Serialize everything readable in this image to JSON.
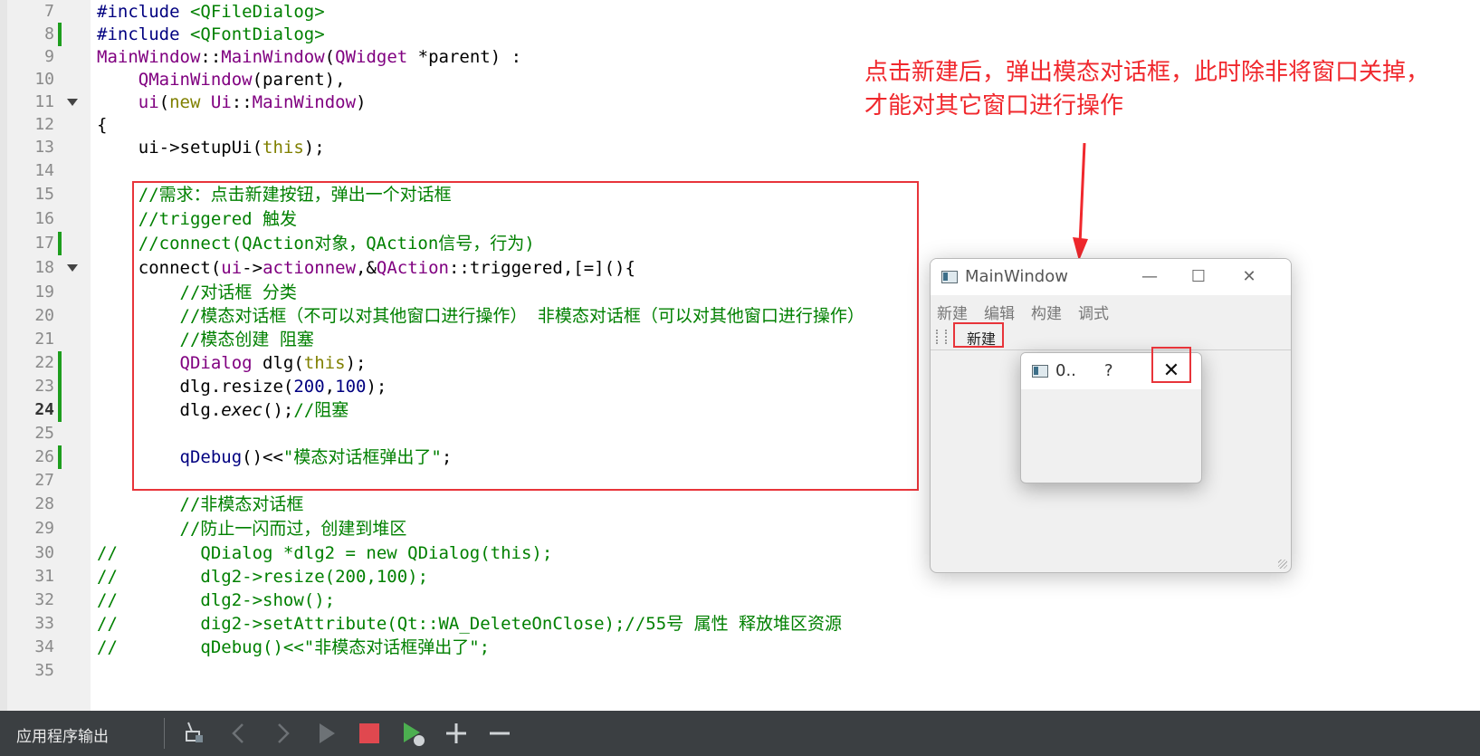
{
  "editor": {
    "lines": [
      {
        "n": "7",
        "segs": [
          {
            "c": "pp",
            "t": "#include "
          },
          {
            "c": "inc",
            "t": "<QFileDialog>"
          }
        ]
      },
      {
        "n": "8",
        "chg": true,
        "segs": [
          {
            "c": "pp",
            "t": "#include "
          },
          {
            "c": "inc",
            "t": "<QFontDialog>"
          }
        ]
      },
      {
        "n": "9",
        "segs": [
          {
            "c": "cls",
            "t": "MainWindow"
          },
          {
            "c": "",
            "t": "::"
          },
          {
            "c": "cls",
            "t": "MainWindow"
          },
          {
            "c": "",
            "t": "("
          },
          {
            "c": "cls",
            "t": "QWidget"
          },
          {
            "c": "",
            "t": " *parent) :"
          }
        ]
      },
      {
        "n": "10",
        "segs": [
          {
            "c": "",
            "t": "    "
          },
          {
            "c": "cls",
            "t": "QMainWindow"
          },
          {
            "c": "",
            "t": "(parent),"
          }
        ]
      },
      {
        "n": "11",
        "fold": true,
        "segs": [
          {
            "c": "",
            "t": "    "
          },
          {
            "c": "cls",
            "t": "ui"
          },
          {
            "c": "",
            "t": "("
          },
          {
            "c": "kw",
            "t": "new"
          },
          {
            "c": "",
            "t": " "
          },
          {
            "c": "cls",
            "t": "Ui"
          },
          {
            "c": "",
            "t": "::"
          },
          {
            "c": "cls",
            "t": "MainWindow"
          },
          {
            "c": "",
            "t": ")"
          }
        ]
      },
      {
        "n": "12",
        "segs": [
          {
            "c": "",
            "t": "{"
          }
        ]
      },
      {
        "n": "13",
        "segs": [
          {
            "c": "",
            "t": "    ui->setupUi("
          },
          {
            "c": "kw",
            "t": "this"
          },
          {
            "c": "",
            "t": ");"
          }
        ]
      },
      {
        "n": "14",
        "segs": []
      },
      {
        "n": "15",
        "segs": [
          {
            "c": "",
            "t": "    "
          },
          {
            "c": "cm",
            "t": "//需求：点击新建按钮，弹出一个对话框"
          }
        ]
      },
      {
        "n": "16",
        "segs": [
          {
            "c": "",
            "t": "    "
          },
          {
            "c": "cm",
            "t": "//triggered 触发"
          }
        ]
      },
      {
        "n": "17",
        "chg": true,
        "segs": [
          {
            "c": "",
            "t": "    "
          },
          {
            "c": "cm",
            "t": "//connect(QAction对象，QAction信号，行为)"
          }
        ]
      },
      {
        "n": "18",
        "fold": true,
        "segs": [
          {
            "c": "",
            "t": "    connect("
          },
          {
            "c": "cls",
            "t": "ui"
          },
          {
            "c": "",
            "t": "->"
          },
          {
            "c": "cls",
            "t": "actionnew"
          },
          {
            "c": "",
            "t": ",&"
          },
          {
            "c": "cls",
            "t": "QAction"
          },
          {
            "c": "",
            "t": "::triggered,[=](){"
          }
        ]
      },
      {
        "n": "19",
        "segs": [
          {
            "c": "",
            "t": "        "
          },
          {
            "c": "cm",
            "t": "//对话框 分类"
          }
        ]
      },
      {
        "n": "20",
        "segs": [
          {
            "c": "",
            "t": "        "
          },
          {
            "c": "cm",
            "t": "//模态对话框（不可以对其他窗口进行操作） 非模态对话框（可以对其他窗口进行操作）"
          }
        ]
      },
      {
        "n": "21",
        "segs": [
          {
            "c": "",
            "t": "        "
          },
          {
            "c": "cm",
            "t": "//模态创建 阻塞"
          }
        ]
      },
      {
        "n": "22",
        "chg": true,
        "segs": [
          {
            "c": "",
            "t": "        "
          },
          {
            "c": "cls",
            "t": "QDialog"
          },
          {
            "c": "",
            "t": " dlg("
          },
          {
            "c": "kw",
            "t": "this"
          },
          {
            "c": "",
            "t": ");"
          }
        ]
      },
      {
        "n": "23",
        "chg": true,
        "segs": [
          {
            "c": "",
            "t": "        dlg.resize("
          },
          {
            "c": "num",
            "t": "200"
          },
          {
            "c": "",
            "t": ","
          },
          {
            "c": "num",
            "t": "100"
          },
          {
            "c": "",
            "t": ");"
          }
        ]
      },
      {
        "n": "24",
        "chg": true,
        "cur": true,
        "segs": [
          {
            "c": "",
            "t": "        dlg."
          },
          {
            "c": "it",
            "t": "exec"
          },
          {
            "c": "",
            "t": "();"
          },
          {
            "c": "cm",
            "t": "//阻塞"
          }
        ]
      },
      {
        "n": "25",
        "segs": []
      },
      {
        "n": "26",
        "chg": true,
        "segs": [
          {
            "c": "",
            "t": "        "
          },
          {
            "c": "pp",
            "t": "qDebug"
          },
          {
            "c": "",
            "t": "()<<"
          },
          {
            "c": "str",
            "t": "\"模态对话框弹出了\""
          },
          {
            "c": "",
            "t": ";"
          }
        ]
      },
      {
        "n": "27",
        "segs": []
      },
      {
        "n": "28",
        "segs": [
          {
            "c": "",
            "t": "        "
          },
          {
            "c": "cm",
            "t": "//非模态对话框"
          }
        ]
      },
      {
        "n": "29",
        "segs": [
          {
            "c": "",
            "t": "        "
          },
          {
            "c": "cm",
            "t": "//防止一闪而过，创建到堆区"
          }
        ]
      },
      {
        "n": "30",
        "segs": [
          {
            "c": "cm",
            "t": "//        QDialog *dlg2 = new QDialog(this);"
          }
        ]
      },
      {
        "n": "31",
        "segs": [
          {
            "c": "cm",
            "t": "//        dlg2->resize(200,100);"
          }
        ]
      },
      {
        "n": "32",
        "segs": [
          {
            "c": "cm",
            "t": "//        dlg2->show();"
          }
        ]
      },
      {
        "n": "33",
        "segs": [
          {
            "c": "cm",
            "t": "//        dig2->setAttribute(Qt::WA_DeleteOnClose);//55号 属性 释放堆区资源"
          }
        ]
      },
      {
        "n": "34",
        "segs": [
          {
            "c": "cm",
            "t": "//        qDebug()<<\"非模态对话框弹出了\";"
          }
        ]
      },
      {
        "n": "35",
        "segs": []
      }
    ]
  },
  "annotation": {
    "text": "点击新建后，弹出模态对话框，此时除非将窗口关掉，才能对其它窗口进行操作",
    "color": "#f0282d"
  },
  "main_window": {
    "title": "MainWindow",
    "menus": [
      "新建",
      "编辑",
      "构建",
      "调式"
    ],
    "toolbar_button": "新建",
    "controls": {
      "minimize": "—",
      "maximize": "☐",
      "close": "✕"
    }
  },
  "dialog": {
    "title": "0..",
    "help": "?",
    "close": "✕"
  },
  "output_panel": {
    "label": "应用程序输出",
    "icons": [
      "clear-icon",
      "prev-icon",
      "next-icon",
      "run-icon",
      "stop-icon",
      "debug-run-icon",
      "zoom-in-icon",
      "zoom-out-icon"
    ]
  }
}
